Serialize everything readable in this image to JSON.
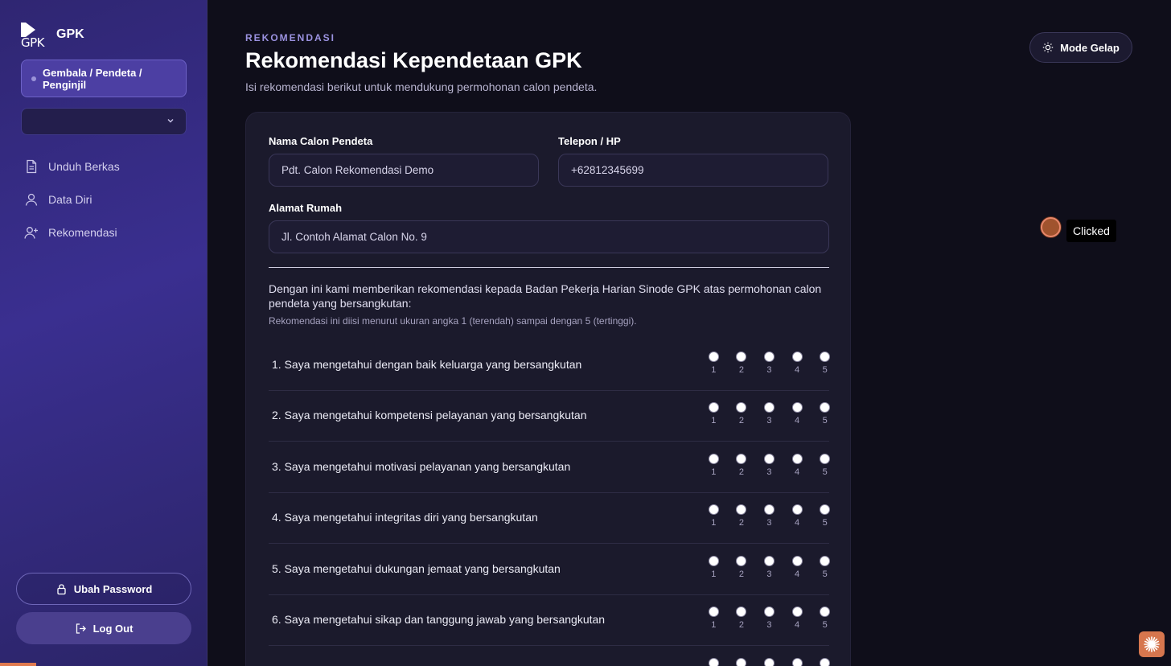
{
  "sidebar": {
    "brand_logo_text": "GPK",
    "brand_name": "GPK",
    "role": "Gembala / Pendeta / Penginjil",
    "select_value": "",
    "nav": [
      {
        "label": "Unduh Berkas",
        "icon": "file-icon"
      },
      {
        "label": "Data Diri",
        "icon": "user-icon"
      },
      {
        "label": "Rekomendasi",
        "icon": "user-plus-icon"
      }
    ],
    "change_password": "Ubah Password",
    "logout": "Log Out"
  },
  "header": {
    "eyebrow": "REKOMENDASI",
    "title": "Rekomendasi Kependetaan GPK",
    "subtitle": "Isi rekomendasi berikut untuk mendukung permohonan calon pendeta.",
    "mode_button": "Mode Gelap"
  },
  "form": {
    "name_label": "Nama Calon Pendeta",
    "name_value": "Pdt. Calon Rekomendasi Demo",
    "phone_label": "Telepon / HP",
    "phone_value": "+62812345699",
    "address_label": "Alamat Rumah",
    "address_value": "Jl. Contoh Alamat Calon No. 9",
    "intro": "Dengan ini kami memberikan rekomendasi kepada Badan Pekerja Harian Sinode GPK atas permohonan calon pendeta yang bersangkutan:",
    "intro_sub": "Rekomendasi ini diisi menurut ukuran angka 1 (terendah) sampai dengan 5 (tertinggi).",
    "scale": [
      "1",
      "2",
      "3",
      "4",
      "5"
    ],
    "questions": [
      "1. Saya mengetahui dengan baik keluarga yang bersangkutan",
      "2. Saya mengetahui kompetensi pelayanan yang bersangkutan",
      "3. Saya mengetahui motivasi pelayanan yang bersangkutan",
      "4. Saya mengetahui integritas diri yang bersangkutan",
      "5. Saya mengetahui dukungan jemaat yang bersangkutan",
      "6. Saya mengetahui sikap dan tanggung jawab yang bersangkutan"
    ]
  },
  "overlay": {
    "click_label": "Clicked"
  },
  "colors": {
    "accent": "#4c3fa3",
    "marker": "#d6764e"
  }
}
